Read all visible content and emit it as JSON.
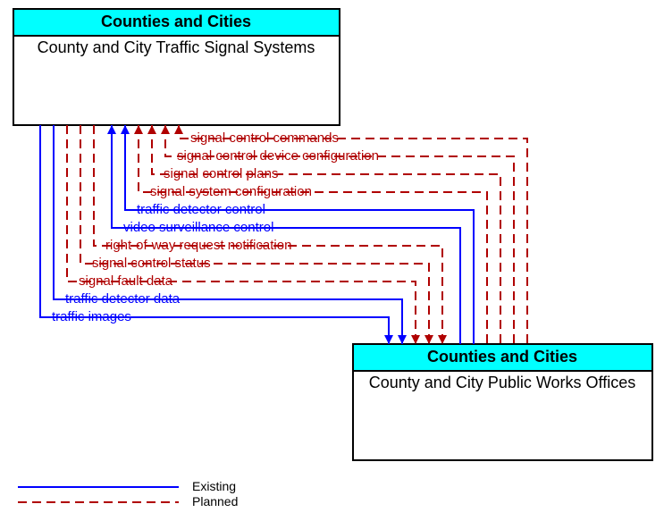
{
  "chart_data": {
    "type": "diagram",
    "nodes": [
      {
        "id": "top",
        "header": "Counties and Cities",
        "title": "County and City Traffic Signal Systems"
      },
      {
        "id": "bottom",
        "header": "Counties and Cities",
        "title": "County and City Public Works Offices"
      }
    ],
    "flows_down": [
      {
        "label": "signal control commands",
        "status": "planned"
      },
      {
        "label": "signal control device configuration",
        "status": "planned"
      },
      {
        "label": "signal control plans",
        "status": "planned"
      },
      {
        "label": "signal system configuration",
        "status": "planned"
      },
      {
        "label": "traffic detector control",
        "status": "existing"
      },
      {
        "label": "video surveillance control",
        "status": "existing"
      }
    ],
    "flows_up": [
      {
        "label": "right-of-way request notification",
        "status": "planned"
      },
      {
        "label": "signal control status",
        "status": "planned"
      },
      {
        "label": "signal fault data",
        "status": "planned"
      },
      {
        "label": "traffic detector data",
        "status": "existing"
      },
      {
        "label": "traffic images",
        "status": "existing"
      }
    ],
    "legend": {
      "existing": "Existing",
      "planned": "Planned"
    },
    "colors": {
      "existing": "#0000ff",
      "planned": "#b00000",
      "header_bg": "#00ffff"
    }
  }
}
